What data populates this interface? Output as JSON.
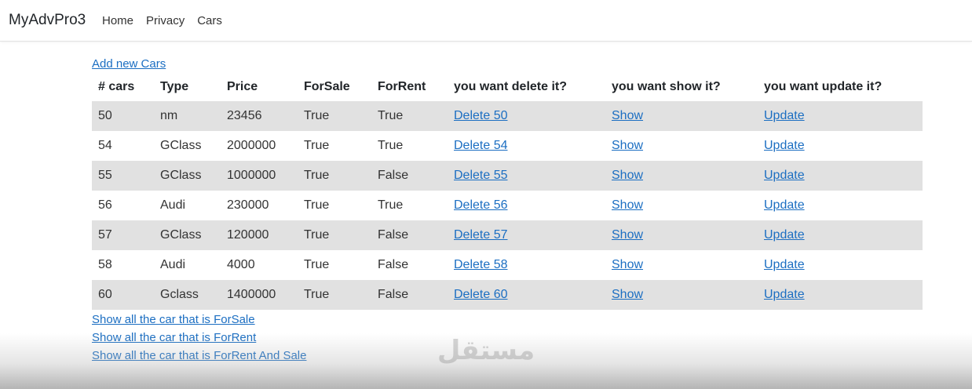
{
  "navbar": {
    "brand": "MyAdvPro3",
    "links": [
      "Home",
      "Privacy",
      "Cars"
    ]
  },
  "add_link": "Add new Cars",
  "table": {
    "headers": [
      "# cars",
      "Type",
      "Price",
      "ForSale",
      "ForRent",
      "you want delete it?",
      "you want show it?",
      "you want update it?"
    ],
    "rows": [
      {
        "id": "50",
        "type": "nm",
        "price": "23456",
        "forsale": "True",
        "forrent": "True",
        "delete": "Delete 50",
        "show": "Show",
        "update": "Update"
      },
      {
        "id": "54",
        "type": "GClass",
        "price": "2000000",
        "forsale": "True",
        "forrent": "True",
        "delete": "Delete 54",
        "show": "Show",
        "update": "Update"
      },
      {
        "id": "55",
        "type": "GClass",
        "price": "1000000",
        "forsale": "True",
        "forrent": "False",
        "delete": "Delete 55",
        "show": "Show",
        "update": "Update"
      },
      {
        "id": "56",
        "type": "Audi",
        "price": "230000",
        "forsale": "True",
        "forrent": "True",
        "delete": "Delete 56",
        "show": "Show",
        "update": "Update"
      },
      {
        "id": "57",
        "type": "GClass",
        "price": "120000",
        "forsale": "True",
        "forrent": "False",
        "delete": "Delete 57",
        "show": "Show",
        "update": "Update"
      },
      {
        "id": "58",
        "type": "Audi",
        "price": "4000",
        "forsale": "True",
        "forrent": "False",
        "delete": "Delete 58",
        "show": "Show",
        "update": "Update"
      },
      {
        "id": "60",
        "type": "Gclass",
        "price": "1400000",
        "forsale": "True",
        "forrent": "False",
        "delete": "Delete 60",
        "show": "Show",
        "update": "Update"
      }
    ]
  },
  "bottom_links": [
    "Show all the car that is ForSale",
    "Show all the car that is ForRent",
    "Show all the car that is ForRent And Sale"
  ],
  "watermark": "مستقل"
}
